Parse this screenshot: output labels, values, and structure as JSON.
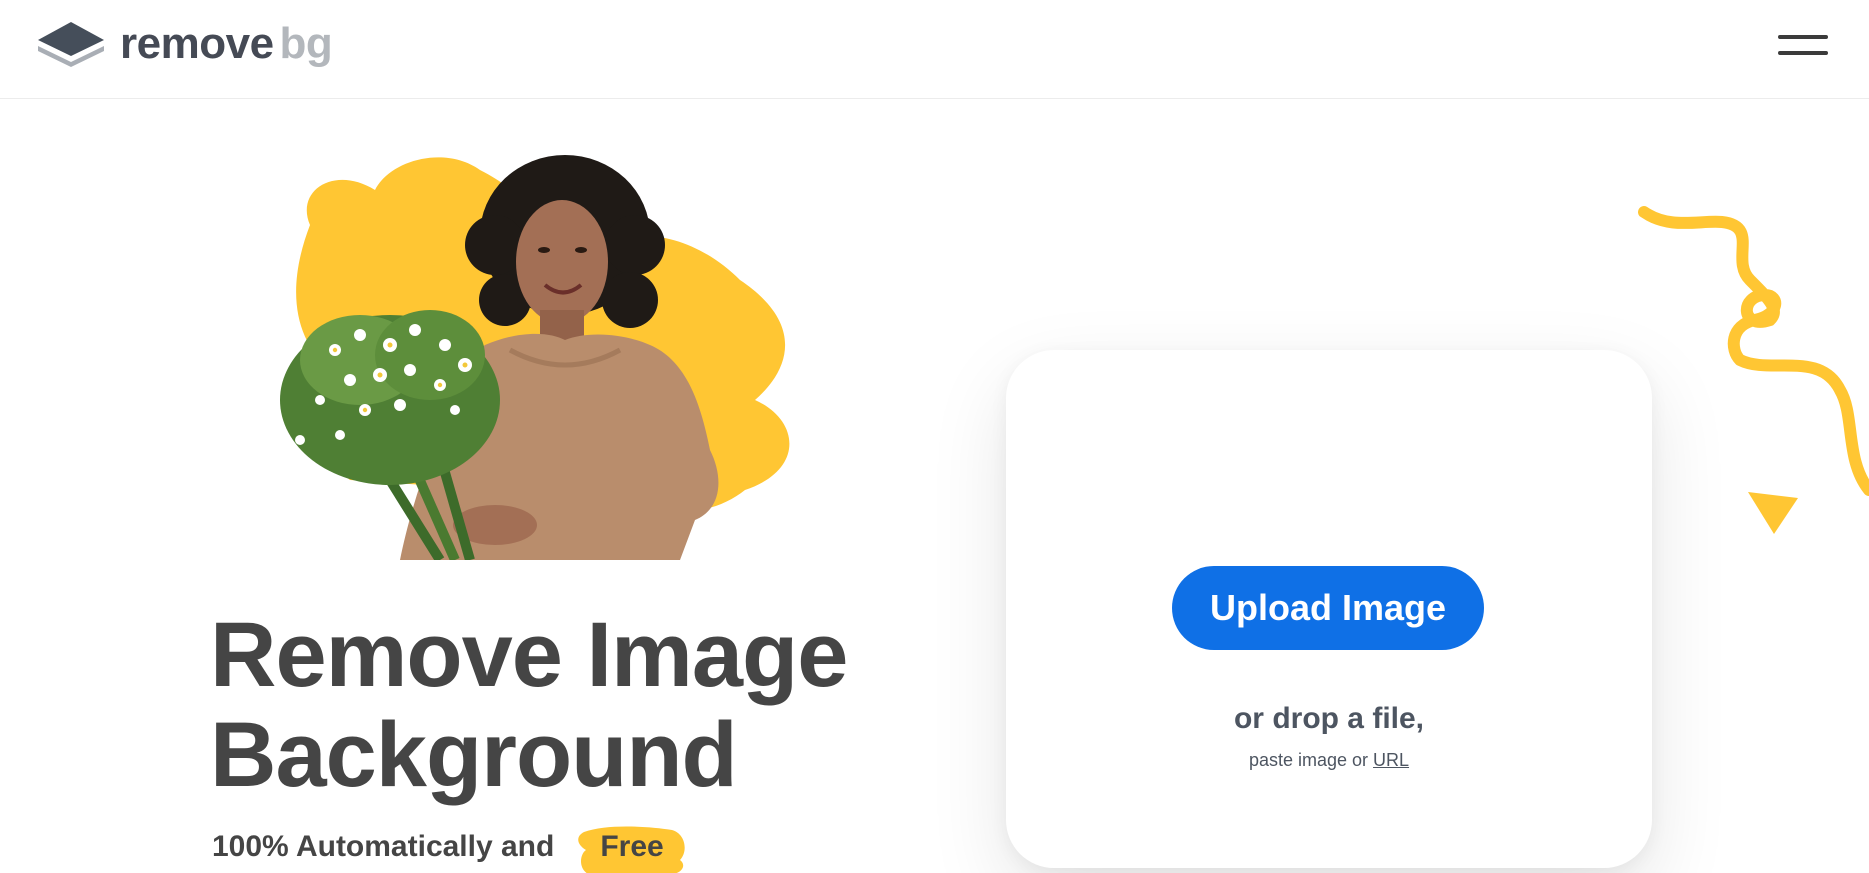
{
  "header": {
    "logo": {
      "word_main": "remove",
      "word_accent": "bg"
    },
    "menu_icon": "hamburger-menu-icon"
  },
  "hero": {
    "image": "woman-holding-flower-bouquet",
    "headline_line1": "Remove Image",
    "headline_line2": "Background",
    "subline_prefix": "100% Automatically and",
    "subline_badge": "Free"
  },
  "upload": {
    "button_label": "Upload Image",
    "drop_text": "or drop a file,",
    "paste_prefix": "paste image or ",
    "url_label": "URL"
  },
  "colors": {
    "accent_blue": "#0f70e6",
    "accent_yellow": "#ffc633",
    "text_dark": "#454545",
    "logo_gray": "#b3b7bc"
  }
}
